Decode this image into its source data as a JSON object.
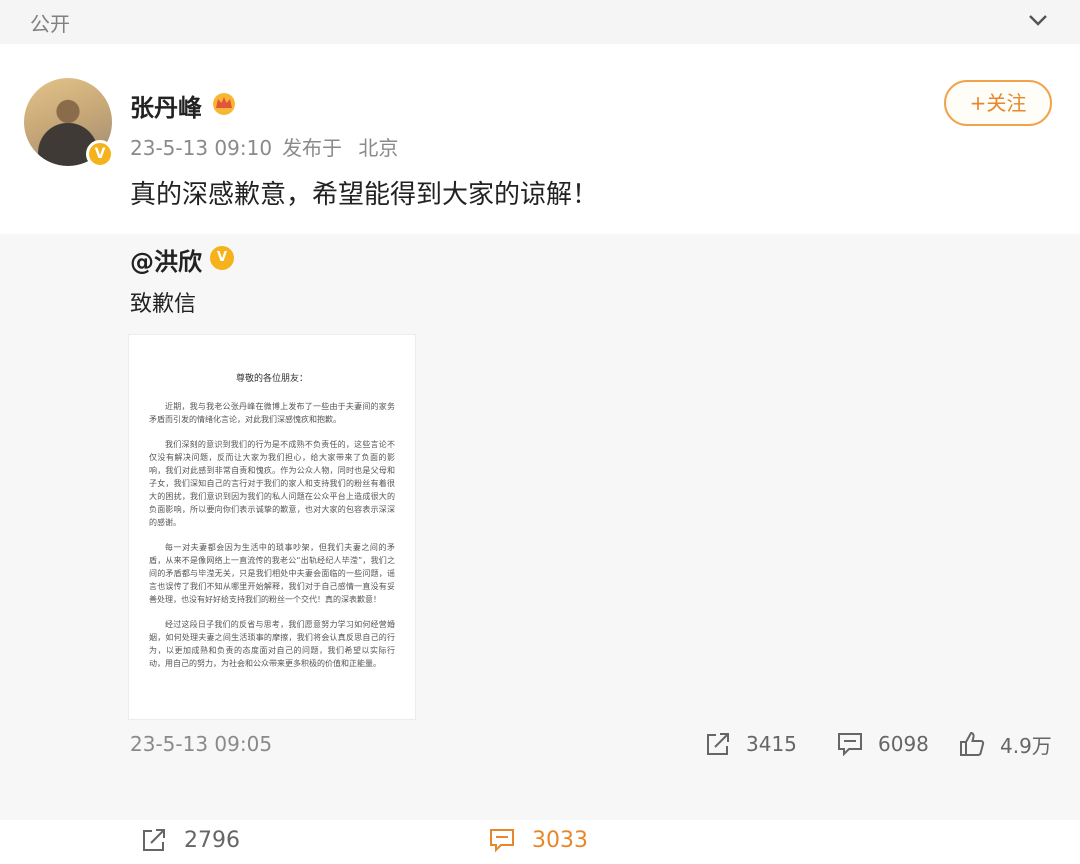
{
  "topbar": {
    "visibility": "公开"
  },
  "post": {
    "author": "张丹峰",
    "timestamp": "23-5-13 09:10",
    "location_prefix": "发布于",
    "location": "北京",
    "follow_label": "+关注",
    "text": "真的深感歉意，希望能得到大家的谅解！"
  },
  "repost": {
    "mention": "@洪欣",
    "text": "致歉信",
    "letter": {
      "title": "尊敬的各位朋友：",
      "paragraphs": [
        "近期，我与我老公张丹峰在微博上发布了一些由于夫妻间的家务矛盾而引发的情绪化言论，对此我们深感愧疚和抱歉。",
        "我们深刻的意识到我们的行为是不成熟不负责任的，这些言论不仅没有解决问题，反而让大家为我们担心，给大家带来了负面的影响，我们对此感到非常自责和愧疚。作为公众人物，同时也是父母和子女，我们深知自己的言行对于我们的家人和支持我们的粉丝有着很大的困扰，我们意识到因为我们的私人问题在公众平台上造成很大的负面影响，所以要向你们表示诚挚的歉意，也对大家的包容表示深深的感谢。",
        "每一对夫妻都会因为生活中的琐事吵架，但我们夫妻之间的矛盾，从来不是像网络上一直流传的我老公“出轨经纪人毕滢”，我们之间的矛盾都与毕滢无关，只是我们相处中夫妻会面临的一些问题，谣言也误传了我们不知从哪里开始解释，我们对于自己感情一直没有妥善处理，也没有好好给支持我们的粉丝一个交代！真的深表歉意！",
        "经过这段日子我们的反省与思考，我们愿意努力学习如何经营婚姻，如何处理夫妻之间生活琐事的摩擦，我们将会认真反思自己的行为，以更加成熟和负责的态度面对自己的问题，我们希望以实际行动，用自己的努力，为社会和公众带来更多积极的价值和正能量。"
      ]
    },
    "timestamp": "23-5-13 09:05",
    "reposts": "3415",
    "comments": "6098",
    "likes": "4.9万"
  },
  "footer": {
    "reposts": "2796",
    "comments": "3033"
  },
  "colors": {
    "accent": "#e8872a",
    "badge": "#f5b21b",
    "muted": "#8a8a8a"
  },
  "icons": [
    "chevron-down-icon",
    "crown-icon",
    "verified-badge-icon",
    "share-icon",
    "comment-icon",
    "like-icon"
  ]
}
